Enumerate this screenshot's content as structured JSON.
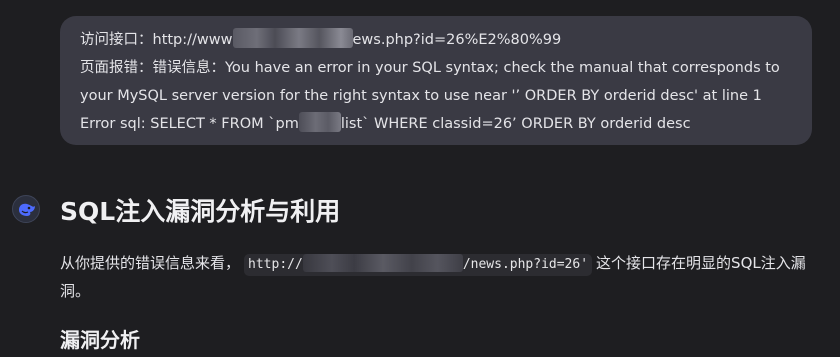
{
  "quoted_message": {
    "line1_prefix": "访问接口：http://www",
    "line1_suffix": "ews.php?id=26%E2%80%99",
    "line2": "页面报错：错误信息：You have an error in your SQL syntax; check the manual that corresponds to",
    "line3": "your MySQL server version for the right syntax to use near '’ ORDER BY orderid desc' at line 1",
    "line4_prefix": "Error sql: SELECT * FROM `pm",
    "line4_suffix": "list` WHERE classid=26’ ORDER BY orderid desc"
  },
  "assistant": {
    "avatar_icon": "assistant-logo-icon",
    "heading": "SQL注入漏洞分析与利用",
    "para_prefix": "从你提供的错误信息来看，",
    "code_prefix": "http://",
    "code_suffix": "/news.php?id=26'",
    "para_suffix": "这个接口存在明显的SQL注入漏洞。",
    "subheading": "漏洞分析"
  },
  "colors": {
    "background": "#1e1e21",
    "bubble": "#3a3a44",
    "text": "#e4e4e8",
    "avatar_accent": "#4d6bfe"
  }
}
